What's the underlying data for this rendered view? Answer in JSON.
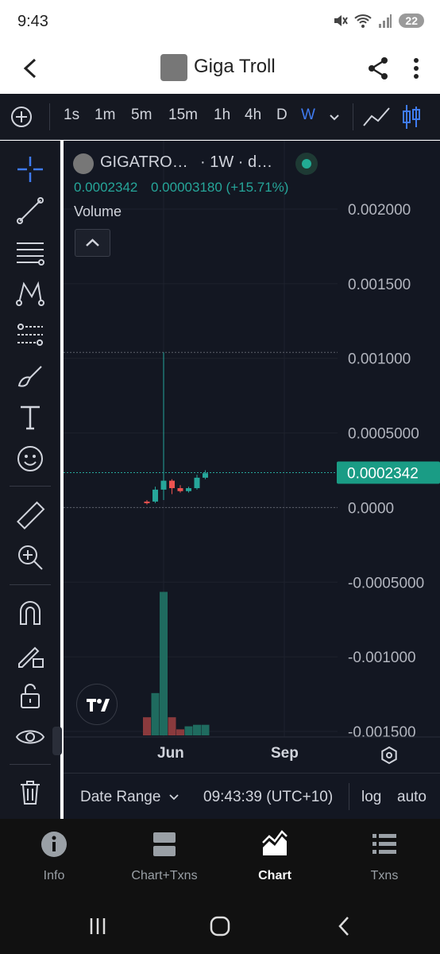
{
  "status": {
    "time": "9:43",
    "battery": "22"
  },
  "app": {
    "title": "Giga Troll"
  },
  "toolbar": {
    "timeframes": [
      "1s",
      "1m",
      "5m",
      "15m",
      "1h",
      "4h",
      "D",
      "W"
    ],
    "active_timeframe": "W"
  },
  "chart": {
    "symbol": "GIGATRO…",
    "interval_label": "· 1W · d…",
    "price": "0.0002342",
    "change": "0.00003180 (+15.71%)",
    "volume_label": "Volume",
    "last_price_tag": "0.0002342",
    "x_labels": [
      "Jun",
      "Sep"
    ]
  },
  "chart_data": {
    "type": "candlestick",
    "y_axis_ticks": [
      "0.002000",
      "0.001500",
      "0.001000",
      "0.0005000",
      "0.0000",
      "-0.0005000",
      "-0.001000",
      "-0.001500"
    ],
    "ylim": [
      -0.0015,
      0.002
    ],
    "x_tick_labels": [
      "Jun",
      "Sep"
    ],
    "last_price": 0.0002342,
    "candles": [
      {
        "open": 4e-05,
        "close": 3e-05,
        "high": 5e-05,
        "low": 2e-05,
        "dir": "down"
      },
      {
        "open": 4e-05,
        "close": 0.00012,
        "high": 0.00014,
        "low": 3e-05,
        "dir": "up"
      },
      {
        "open": 0.00012,
        "close": 0.00018,
        "high": 0.00104,
        "low": 5e-05,
        "dir": "up"
      },
      {
        "open": 0.00018,
        "close": 0.00013,
        "high": 0.00019,
        "low": 9e-05,
        "dir": "down"
      },
      {
        "open": 0.00013,
        "close": 0.00011,
        "high": 0.00015,
        "low": 0.0001,
        "dir": "down"
      },
      {
        "open": 0.00011,
        "close": 0.00013,
        "high": 0.00014,
        "low": 0.0001,
        "dir": "up"
      },
      {
        "open": 0.00013,
        "close": 0.0002,
        "high": 0.00022,
        "low": 0.00012,
        "dir": "up"
      },
      {
        "open": 0.0002,
        "close": 0.00023,
        "high": 0.00025,
        "low": 0.00019,
        "dir": "up"
      }
    ],
    "volume": [
      {
        "v": 0.12,
        "dir": "down"
      },
      {
        "v": 0.28,
        "dir": "up"
      },
      {
        "v": 0.95,
        "dir": "up"
      },
      {
        "v": 0.12,
        "dir": "down"
      },
      {
        "v": 0.04,
        "dir": "down"
      },
      {
        "v": 0.06,
        "dir": "up"
      },
      {
        "v": 0.07,
        "dir": "up"
      },
      {
        "v": 0.07,
        "dir": "up"
      }
    ],
    "colors": {
      "up": "#26a69a",
      "down": "#ef5350",
      "tag": "#1a9c85"
    }
  },
  "bottom": {
    "date_range": "Date Range",
    "time": "09:43:39 (UTC+10)",
    "log": "log",
    "auto": "auto"
  },
  "nav": {
    "items": [
      {
        "label": "Info",
        "icon": "info-icon"
      },
      {
        "label": "Chart+Txns",
        "icon": "split-icon"
      },
      {
        "label": "Chart",
        "icon": "chart-icon"
      },
      {
        "label": "Txns",
        "icon": "list-icon"
      }
    ],
    "active": "Chart"
  }
}
